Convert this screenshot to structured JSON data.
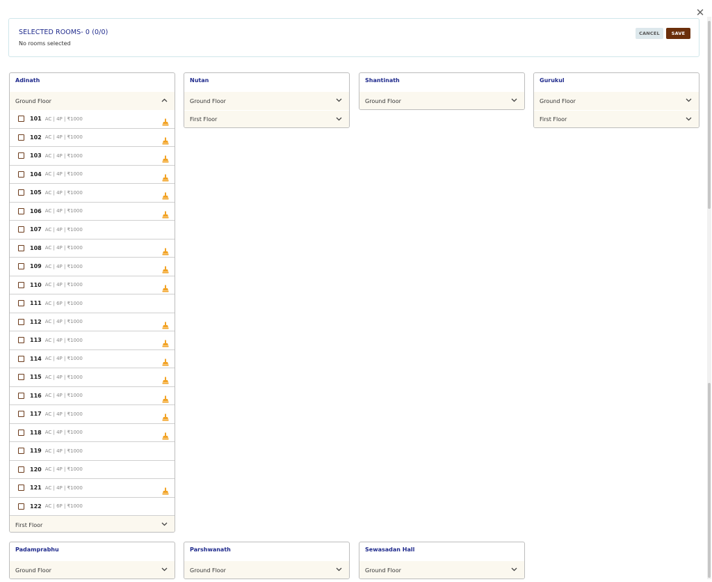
{
  "summary": {
    "title": "SELECTED ROOMS- 0 (0/0)",
    "subtitle": "No rooms selected",
    "cancel_label": "CANCEL",
    "save_label": "SAVE"
  },
  "buildings": {
    "adinath": {
      "name": "Adinath",
      "ground_floor": "Ground Floor",
      "first_floor": "First Floor",
      "rooms": [
        {
          "num": "101",
          "info": "AC | 4P | ₹1000",
          "icon": true
        },
        {
          "num": "102",
          "info": "AC | 4P | ₹1000",
          "icon": true
        },
        {
          "num": "103",
          "info": "AC | 4P | ₹1000",
          "icon": true
        },
        {
          "num": "104",
          "info": "AC | 4P | ₹1000",
          "icon": true
        },
        {
          "num": "105",
          "info": "AC | 4P | ₹1000",
          "icon": true
        },
        {
          "num": "106",
          "info": "AC | 4P | ₹1000",
          "icon": true
        },
        {
          "num": "107",
          "info": "AC | 4P | ₹1000",
          "icon": false
        },
        {
          "num": "108",
          "info": "AC | 4P | ₹1000",
          "icon": true
        },
        {
          "num": "109",
          "info": "AC | 4P | ₹1000",
          "icon": true
        },
        {
          "num": "110",
          "info": "AC | 4P | ₹1000",
          "icon": true
        },
        {
          "num": "111",
          "info": "AC | 6P | ₹1000",
          "icon": false
        },
        {
          "num": "112",
          "info": "AC | 4P | ₹1000",
          "icon": true
        },
        {
          "num": "113",
          "info": "AC | 4P | ₹1000",
          "icon": true
        },
        {
          "num": "114",
          "info": "AC | 4P | ₹1000",
          "icon": true
        },
        {
          "num": "115",
          "info": "AC | 4P | ₹1000",
          "icon": true
        },
        {
          "num": "116",
          "info": "AC | 4P | ₹1000",
          "icon": true
        },
        {
          "num": "117",
          "info": "AC | 4P | ₹1000",
          "icon": true
        },
        {
          "num": "118",
          "info": "AC | 4P | ₹1000",
          "icon": true
        },
        {
          "num": "119",
          "info": "AC | 4P | ₹1000",
          "icon": false
        },
        {
          "num": "120",
          "info": "AC | 4P | ₹1000",
          "icon": false
        },
        {
          "num": "121",
          "info": "AC | 4P | ₹1000",
          "icon": true
        },
        {
          "num": "122",
          "info": "AC | 6P | ₹1000",
          "icon": false
        }
      ]
    },
    "nutan": {
      "name": "Nutan",
      "ground_floor": "Ground Floor",
      "first_floor": "First Floor"
    },
    "shantinath": {
      "name": "Shantinath",
      "ground_floor": "Ground Floor"
    },
    "gurukul": {
      "name": "Gurukul",
      "ground_floor": "Ground Floor",
      "first_floor": "First Floor"
    },
    "padamprabhu": {
      "name": "Padamprabhu",
      "ground_floor": "Ground Floor"
    },
    "parshwanath": {
      "name": "Parshwanath",
      "ground_floor": "Ground Floor"
    },
    "sewasadan": {
      "name": "Sewasadan Hall",
      "ground_floor": "Ground Floor"
    }
  },
  "colors": {
    "title_blue": "#1f2a8c",
    "save_brown": "#6b2f0b",
    "floor_bg": "#fbf8ef",
    "icon_orange": "#f2a326"
  },
  "icons": {
    "close": "close-icon",
    "expand": "chevron-down-icon",
    "collapse": "chevron-up-icon",
    "room_status": "broom-icon"
  }
}
